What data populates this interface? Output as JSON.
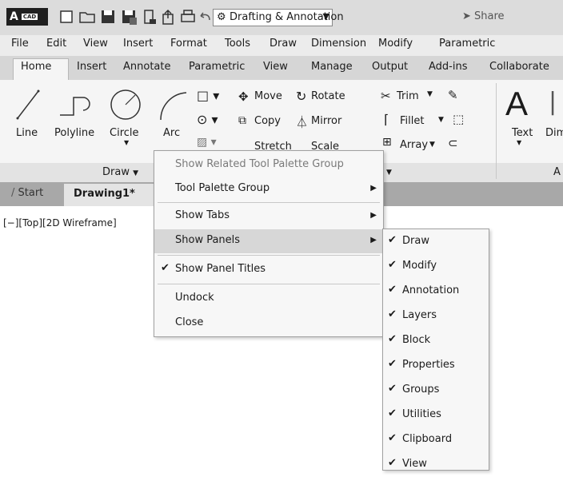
{
  "app": {
    "logo": "A",
    "logo_badge": "CAD"
  },
  "workspace": {
    "label": "Drafting & Annotation"
  },
  "share_label": "Share",
  "menubar": [
    "File",
    "Edit",
    "View",
    "Insert",
    "Format",
    "Tools",
    "Draw",
    "Dimension",
    "Modify",
    "Parametric"
  ],
  "ribbon_tabs": [
    "Home",
    "Insert",
    "Annotate",
    "Parametric",
    "View",
    "Manage",
    "Output",
    "Add-ins",
    "Collaborate"
  ],
  "ribbon": {
    "draw_tools": [
      "Line",
      "Polyline",
      "Circle",
      "Arc"
    ],
    "modify_tools": [
      "Move",
      "Rotate",
      "Trim",
      "Copy",
      "Mirror",
      "Fillet",
      "Stretch",
      "Scale",
      "Array"
    ],
    "annotation_tools": [
      "Text",
      "Dim"
    ],
    "panel_draw_title": "Draw",
    "panel_annotation_title_partial": "A"
  },
  "file_tabs": {
    "start": "Start",
    "drawing": "Drawing1*"
  },
  "viewport_label": "[−][Top][2D Wireframe]",
  "context_menu": {
    "show_related": "Show Related Tool Palette Group",
    "tool_palette_group": "Tool Palette Group",
    "show_tabs": "Show Tabs",
    "show_panels": "Show Panels",
    "show_panel_titles": "Show Panel Titles",
    "undock": "Undock",
    "close": "Close"
  },
  "submenu": [
    "Draw",
    "Modify",
    "Annotation",
    "Layers",
    "Block",
    "Properties",
    "Groups",
    "Utilities",
    "Clipboard",
    "View"
  ],
  "colors": {
    "qat_bg": "#dcdcdc",
    "ribbon_bg": "#f5f5f5",
    "menu_hover": "#d7d7d7"
  }
}
